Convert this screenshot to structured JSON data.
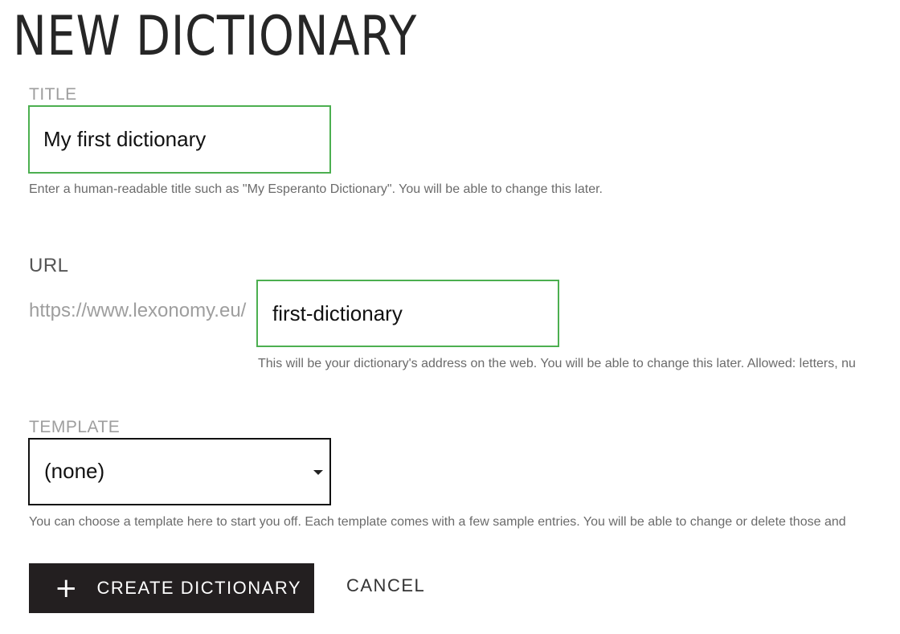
{
  "page": {
    "title": "NEW DICTIONARY"
  },
  "title_field": {
    "label": "TITLE",
    "value": "My first dictionary",
    "helper": "Enter a human-readable title such as \"My Esperanto Dictionary\". You will be able to change this later."
  },
  "url_field": {
    "label": "URL",
    "prefix": "https://www.lexonomy.eu/",
    "value": "first-dictionary",
    "helper": "This will be your dictionary's address on the web. You will be able to change this later. Allowed: letters, nu"
  },
  "template_field": {
    "label": "TEMPLATE",
    "selected": "(none)",
    "helper": "You can choose a template here to start you off. Each template comes with a few sample entries. You will be able to change or delete those and"
  },
  "actions": {
    "create_label": "CREATE DICTIONARY",
    "cancel_label": "CANCEL"
  },
  "colors": {
    "focus_border": "#4caf50",
    "primary_button": "#231f20"
  },
  "icons": {
    "create": "plus-icon",
    "select": "chevron-down-icon"
  }
}
